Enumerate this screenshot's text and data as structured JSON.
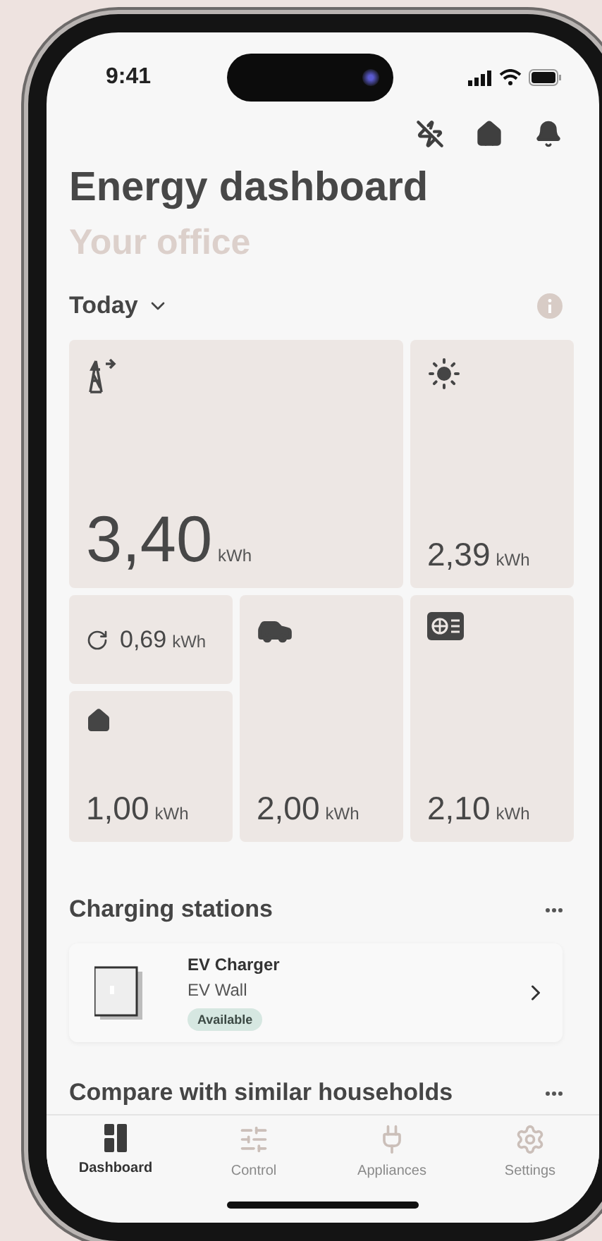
{
  "status_bar": {
    "time": "9:41"
  },
  "header": {
    "title": "Energy dashboard",
    "subtitle": "Your office"
  },
  "period": {
    "label": "Today"
  },
  "tiles": [
    {
      "kind": "grid",
      "value": "3,40",
      "unit": "kWh"
    },
    {
      "kind": "solar",
      "value": "2,39",
      "unit": "kWh"
    },
    {
      "kind": "daily",
      "value": "0,69",
      "unit": "kWh"
    },
    {
      "kind": "home",
      "value": "1,00",
      "unit": "kWh"
    },
    {
      "kind": "car",
      "value": "2,00",
      "unit": "kWh"
    },
    {
      "kind": "heatpump",
      "value": "2,10",
      "unit": "kWh"
    }
  ],
  "charging": {
    "title": "Charging stations",
    "stations": [
      {
        "name": "EV Charger",
        "model": "EV Wall",
        "status": "Available"
      }
    ]
  },
  "compare": {
    "title": "Compare with similar households"
  },
  "tab_bar": [
    {
      "kind": "dashboard",
      "label": "Dashboard",
      "selected": true
    },
    {
      "kind": "control",
      "label": "Control",
      "selected": false
    },
    {
      "kind": "appliances",
      "label": "Appliances",
      "selected": false
    },
    {
      "kind": "settings",
      "label": "Settings",
      "selected": false
    }
  ]
}
